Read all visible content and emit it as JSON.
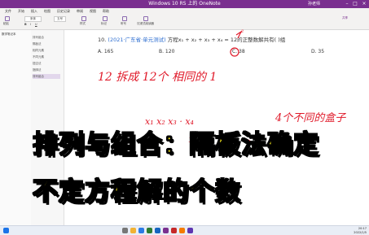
{
  "window": {
    "title": "Windows 10 RS 上的 OneNote",
    "user": "孙老师"
  },
  "ribbon": {
    "tabs": [
      "文件",
      "开始",
      "插入",
      "绘图",
      "历史记录",
      "审阅",
      "视图",
      "帮助"
    ],
    "labels": [
      "粘贴",
      "宋体",
      "五号",
      "样式",
      "标记",
      "听写",
      "沉浸式阅读器",
      "共享"
    ]
  },
  "sidebar": {
    "notebook": "数学笔记本"
  },
  "pages": [
    "排列组合",
    "隔板法",
    "相同元素",
    "不同元素",
    "插空法",
    "捆绑法",
    "排列组合"
  ],
  "question": {
    "number": "10.",
    "source": "(2021·广东省·单元测试)",
    "stem": "方程x₁ + x₂ + x₃ + x₄ = 12的正整数解共有(   )组"
  },
  "options": [
    "A. 165",
    "B. 120",
    "C. 38",
    "D. 35"
  ],
  "handwriting": {
    "line1": "12 拆成 12个 相同的 1",
    "line2a": "x₁  x₂   x₃  · x₄",
    "line2b": "4个不同的盒子",
    "mark": "1",
    "mark2": "2"
  },
  "overlay": {
    "line1": "排列与组合：隔板法确定",
    "line2": "不定方程解的个数"
  },
  "taskbar": {
    "time": "20:17",
    "date": "2022/1/5"
  },
  "colors": {
    "titlebar": "#7a2f8f",
    "ink": "#e01a2a",
    "overlay_text": "#f3e61a",
    "source_link": "#2f6fd1"
  }
}
